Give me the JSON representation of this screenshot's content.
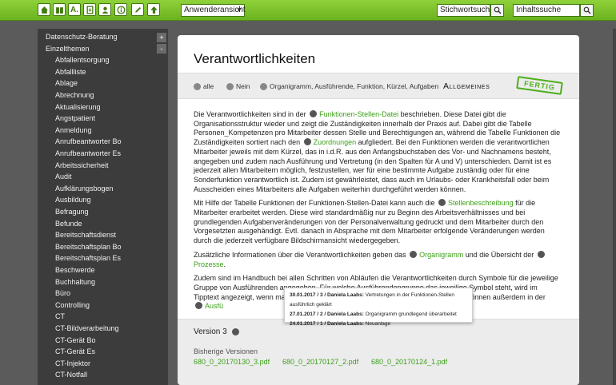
{
  "toolbar": {
    "view_select": "Anwenderansicht",
    "keyword_search": "Stichwortsuche",
    "content_search": "Inhaltssuche",
    "a_button": "A.",
    "accent": "#6bb21f"
  },
  "sidebar": {
    "top_items": [
      "Datenschutz-Beratung",
      "Einzelthemen"
    ],
    "items": [
      "Abfallentsorgung",
      "Abfallliste",
      "Ablage",
      "Abrechnung",
      "Aktualisierung",
      "Angstpatient",
      "Anmeldung",
      "Anrufbeantworter Bo",
      "Anrufbeantworter Es",
      "Arbeitssicherheit",
      "Audit",
      "Aufklärungsbogen",
      "Ausbildung",
      "Befragung",
      "Befunde",
      "Bereitschaftsdienst",
      "Bereitschaftsplan Bo",
      "Bereitschaftsplan Es",
      "Beschwerde",
      "Buchhaltung",
      "Büro",
      "Controlling",
      "CT",
      "CT-Bildverarbeitung",
      "CT-Gerät Bo",
      "CT-Gerät Es",
      "CT-Injektor",
      "CT-Notfall"
    ],
    "plus": "+",
    "minus": "-"
  },
  "page": {
    "title": "Verantwortlichkeiten",
    "filters": {
      "all": "alle",
      "none": "Nein",
      "fields": "Organigramm, Ausführende, Funktion, Kürzel, Aufgaben"
    },
    "section": "Allgemeines",
    "stamp": "FERTIG",
    "p1": [
      "Die Verantwortlichkeiten sind in der ",
      "Funktionen-Stellen-Datei",
      " beschrieben. Diese Datei gibt die Organisationsstruktur wieder und zeigt die Zuständigkeiten innerhalb der Praxis auf. Dabei gibt die Tabelle Personen_Kompetenzen pro Mitarbeiter dessen Stelle und Berechtigungen an, während die Tabelle Funktionen die Zuständigkeiten sortiert nach den ",
      "Zuordnungen",
      " aufgliedert. Bei den Funktionen werden die verantwortlichen Mitarbeiter jeweils mit dem Kürzel, das in i.d.R. aus den Anfangsbuchstaben des Vor- und Nachnamens besteht, angegeben und zudem nach Ausführung und Vertretung (in den Spalten für A und V) unterschieden. Damit ist es jederzeit allen Mitarbeitern möglich, festzustellen, wer für eine bestimmte Aufgabe zuständig oder für eine Sonderfunktion verantwortlich ist. Zudem ist gewährleistet, dass auch im Urlaubs- oder Krankheitsfall oder beim Ausscheiden eines Mitarbeiters alle Aufgaben weiterhin durchgeführt werden können."
    ],
    "p2": [
      "Mit Hilfe der Tabelle Funktionen der Funktionen-Stellen-Datei kann auch die ",
      "Stellenbeschreibung",
      " für die Mitarbeiter erarbeitet werden. Diese wird standardmäßig nur zu Beginn des Arbeitsverhältnisses und bei grundlegenden Aufgabenveränderungen von der Personalverwaltung gedruckt und dem Mitarbeiter durch den Vorgesetzten ausgehändigt. Evtl. danach in Absprache mit dem Mitarbeiter erfolgende Veränderungen werden durch die jederzeit verfügbare Bildschirmansicht wiedergegeben."
    ],
    "p3": [
      "Zusätzliche Informationen über die Verantwortlichkeiten geben das ",
      "Organigramm",
      " und die Übersicht der ",
      "Prozesse",
      "."
    ],
    "p4": [
      "Zudem sind im Handbuch bei allen Schritten von Abläufen die Verantwortlichkeiten durch Symbole für die jeweilige Gruppe von Ausführenden angegeben. Für welche Ausführendengruppe das jeweilige Symbol steht, wird im Tipptext angezeigt, wenn man",
      "können außerdem in der",
      "Ausfü"
    ]
  },
  "tooltip": [
    {
      "meta": "30.01.2017 / 3 / Daniela Laabs:",
      "text": " Vertretungen in der Funktionen-Stellen ausführlich geklärt"
    },
    {
      "meta": "27.01.2017 / 2 / Daniela Laabs:",
      "text": " Organigramm grundlegend überarbeitet"
    },
    {
      "meta": "24.01.2017 / 1 / Daniela Laabs:",
      "text": " Neuanlage"
    }
  ],
  "versions": {
    "current": "Version 3",
    "history_label": "Bisherige Versionen",
    "files": [
      "680_0_20170130_3.pdf",
      "680_0_20170127_2.pdf",
      "680_0_20170124_1.pdf"
    ]
  }
}
